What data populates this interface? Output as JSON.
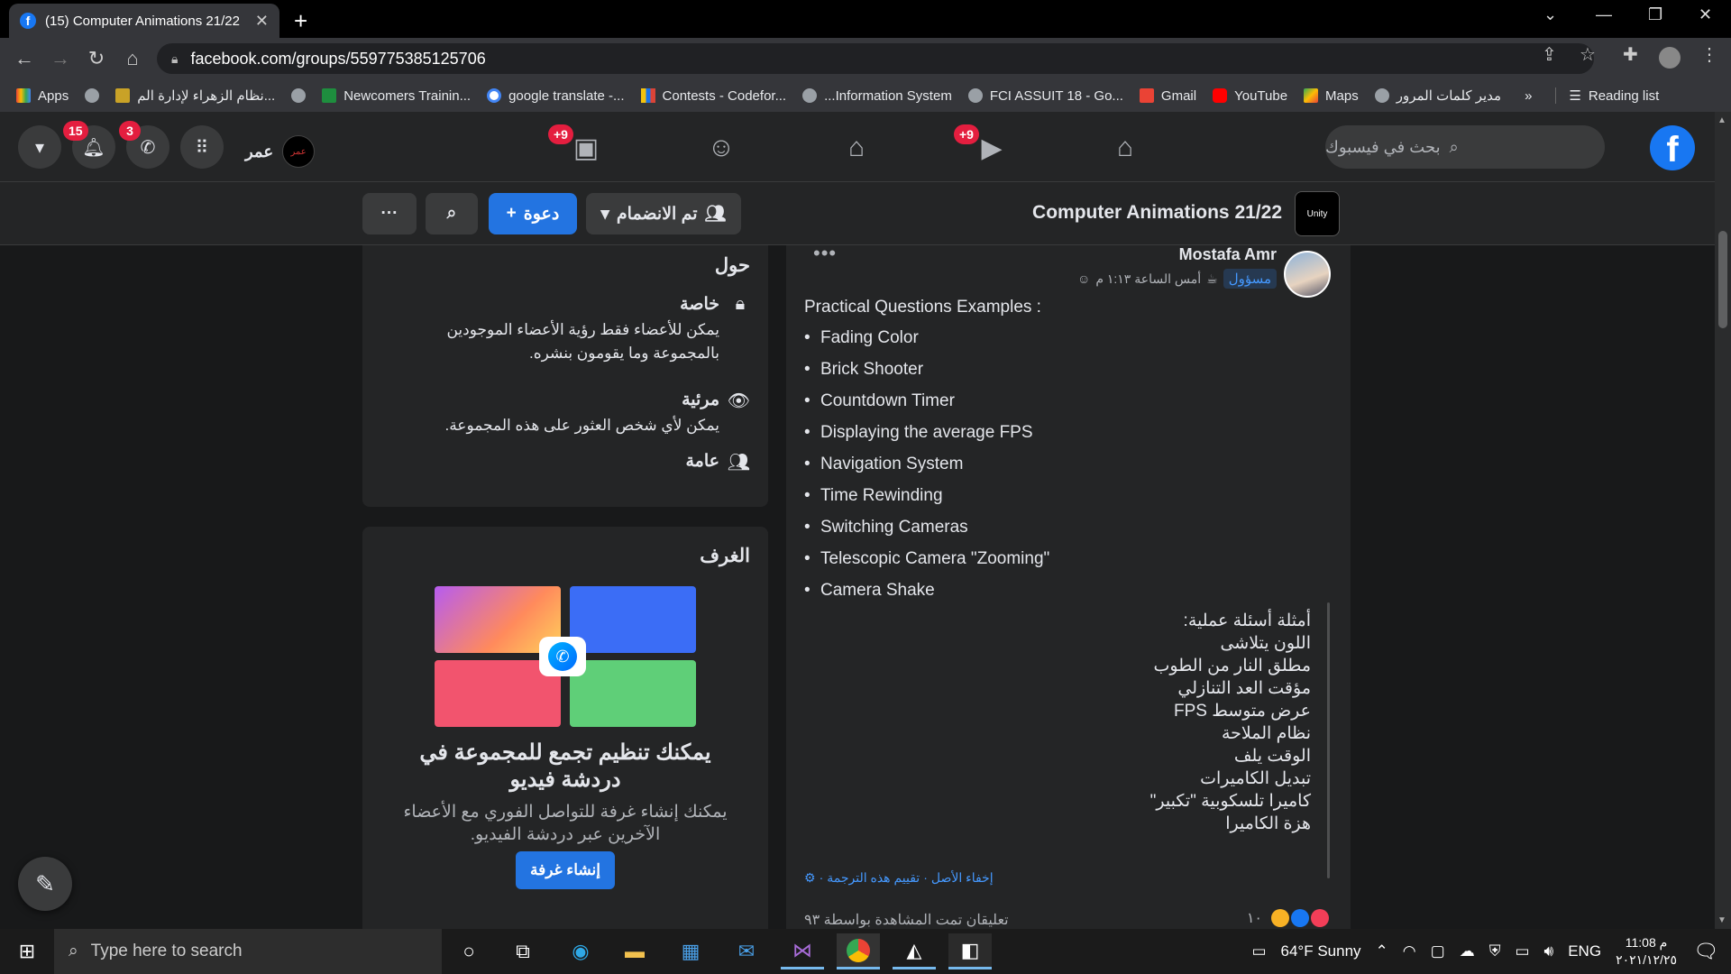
{
  "browser": {
    "tab_title": "(15) Computer Animations 21/22",
    "tab_close": "✕",
    "new_tab": "+",
    "url": "facebook.com/groups/559775385125706",
    "bookmarks": [
      {
        "label": "Apps",
        "icon": "apps-grid-icon"
      },
      {
        "label": "",
        "icon": "globe-icon"
      },
      {
        "label": "نظام الزهراء لإدارة الم...",
        "icon": "site-icon"
      },
      {
        "label": "",
        "icon": "globe-icon"
      },
      {
        "label": "Newcomers Trainin...",
        "icon": "plus-green-icon"
      },
      {
        "label": "google translate -...",
        "icon": "google-icon"
      },
      {
        "label": "Contests - Codefor...",
        "icon": "codeforces-icon"
      },
      {
        "label": "...Information System",
        "icon": "globe-icon"
      },
      {
        "label": "FCI ASSUIT 18 - Go...",
        "icon": "globe-icon"
      },
      {
        "label": "Gmail",
        "icon": "gmail-icon"
      },
      {
        "label": "YouTube",
        "icon": "youtube-icon"
      },
      {
        "label": "Maps",
        "icon": "maps-icon"
      },
      {
        "label": "مدير كلمات المرور",
        "icon": "globe-icon"
      }
    ],
    "bookmarks_more": "»",
    "reading_list": "Reading list"
  },
  "fb": {
    "user_name": "عمر",
    "user_avatar_text": "عمر",
    "notif_count": "15",
    "messenger_count": "3",
    "groups_badge": "+9",
    "watch_badge": "+9",
    "search_placeholder": "بحث في فيسبوك",
    "logo": "f"
  },
  "group": {
    "title": "Computer Animations 21/22",
    "thumb_text": "Unity",
    "joined_label": "تم الانضمام",
    "invite_label": "دعوة",
    "more_label": "···"
  },
  "about": {
    "heading": "حول",
    "private_title": "خاصة",
    "private_desc": "يمكن للأعضاء فقط رؤية الأعضاء الموجودين بالمجموعة وما يقومون بنشره.",
    "visible_title": "مرئية",
    "visible_desc": "يمكن لأي شخص العثور على هذه المجموعة.",
    "general_title": "عامة"
  },
  "rooms": {
    "heading": "الغرف",
    "headline": "يمكنك تنظيم تجمع للمجموعة في دردشة فيديو",
    "sub": "يمكنك إنشاء غرفة للتواصل الفوري مع الأعضاء الآخرين عبر دردشة الفيديو.",
    "button": "إنشاء غرفة"
  },
  "post": {
    "author": "Mostafa Amr",
    "role": "مسؤول",
    "time": "أمس الساعة ١:١٣ م",
    "intro": "Practical Questions Examples :",
    "items": [
      "Fading Color",
      "Brick Shooter",
      "Countdown Timer",
      "Displaying the average FPS",
      "Navigation System",
      "Time Rewinding",
      "Switching Cameras",
      "Telescopic Camera \"Zooming\"",
      "Camera Shake"
    ],
    "translation": [
      "أمثلة أسئلة عملية:",
      "اللون يتلاشى",
      "مطلق النار من الطوب",
      "مؤقت العد التنازلي",
      "عرض متوسط FPS",
      "نظام الملاحة",
      "الوقت يلف",
      "تبديل الكاميرات",
      "كاميرا تلسكوبية \"تكبير\"",
      "هزة الكاميرا"
    ],
    "hide_original": "إخفاء الأصل",
    "rate_translation": "تقييم هذه الترجمة",
    "comments_line": "تعليقان  تمت المشاهدة بواسطة ٩٣",
    "reaction_count": "١٠"
  },
  "taskbar": {
    "search_placeholder": "Type here to search",
    "weather": "64°F  Sunny",
    "lang": "ENG",
    "time": "11:08 م",
    "date": "٢٠٢١/١٢/٢٥"
  },
  "colors": {
    "fb_blue": "#1877f2",
    "button_blue": "#2374e1",
    "badge_red": "#e41e3f",
    "card_bg": "#242526",
    "page_bg": "#18191a"
  }
}
